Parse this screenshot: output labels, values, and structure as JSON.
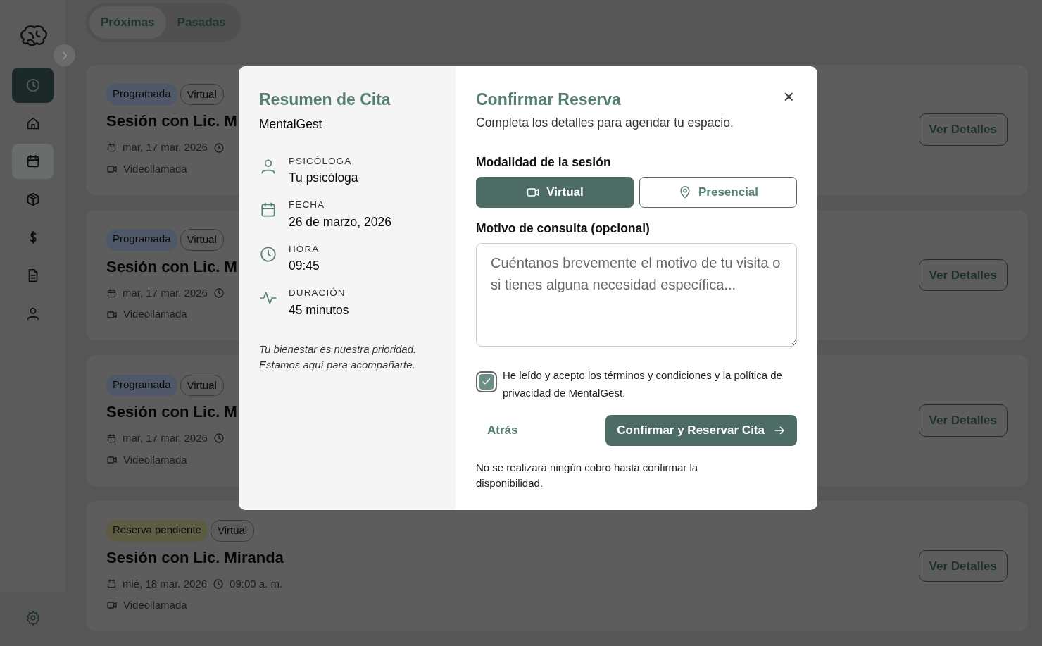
{
  "sidebar": {
    "items": [
      {
        "selected": true,
        "highlighted": false
      },
      {
        "selected": false,
        "highlighted": false
      },
      {
        "selected": false,
        "highlighted": true
      },
      {
        "selected": false,
        "highlighted": false
      },
      {
        "selected": false,
        "highlighted": false
      },
      {
        "selected": false,
        "highlighted": false
      },
      {
        "selected": false,
        "highlighted": false
      }
    ]
  },
  "tabs": [
    {
      "label": "Próximas",
      "selected": true
    },
    {
      "label": "Pasadas",
      "selected": false
    }
  ],
  "appointments": [
    {
      "status": {
        "label": "Programada",
        "color": "#4f5868"
      },
      "mode": "Virtual",
      "title": "Sesión con Lic. M",
      "date": "mar, 17 mar. 2026",
      "channel": "Videollamada",
      "button": "Ver Detalles"
    },
    {
      "status": {
        "label": "Programada",
        "color": "#4f5868"
      },
      "mode": "Virtual",
      "title": "Sesión con Lic. M",
      "date": "mar, 17 mar. 2026",
      "channel": "Videollamada",
      "button": "Ver Detalles"
    },
    {
      "status": {
        "label": "Programada",
        "color": "#4f5868"
      },
      "mode": "Virtual",
      "title": "Sesión con Lic. M",
      "date": "mar, 17 mar. 2026",
      "channel": "Videollamada",
      "button": "Ver Detalles"
    },
    {
      "status": {
        "label": "Reserva pendiente",
        "color": "#5e5b43"
      },
      "mode": "Virtual",
      "title": "Sesión con Lic. Miranda",
      "date": "mié, 18 mar. 2026",
      "time": "09:00 a. m.",
      "channel": "Videollamada",
      "button": "Ver Detalles"
    }
  ],
  "modal": {
    "summary": {
      "title": "Resumen de Cita",
      "brand": "MentalGest",
      "details": [
        {
          "label": "PSICÓLOGA",
          "value": "Tu psicóloga"
        },
        {
          "label": "FECHA",
          "value": "26 de marzo, 2026"
        },
        {
          "label": "HORA",
          "value": "09:45"
        },
        {
          "label": "DURACIÓN",
          "value": "45 minutos"
        }
      ],
      "note": "Tu bienestar es nuestra prioridad. Estamos aquí para acompañarte."
    },
    "form": {
      "title": "Confirmar Reserva",
      "subtitle": "Completa los detalles para agendar tu espacio.",
      "close": "×",
      "modality_label": "Modalidad de la sesión",
      "modalities": [
        {
          "label": "Virtual",
          "selected": true
        },
        {
          "label": "Presencial",
          "selected": false
        }
      ],
      "reason_label": "Motivo de consulta (opcional)",
      "reason": {
        "placeholder": "Cuéntanos brevemente el motivo de tu visita o si tienes alguna necesidad específica..."
      },
      "terms": {
        "text": "He leído y acepto los términos y condiciones y la política de privacidad de MentalGest.",
        "checked": true
      },
      "back": "Atrás",
      "confirm": "Confirmar y Reservar Cita",
      "disclaimer": "No se realizará ningún cobro hasta confirmar la disponibilidad."
    }
  }
}
